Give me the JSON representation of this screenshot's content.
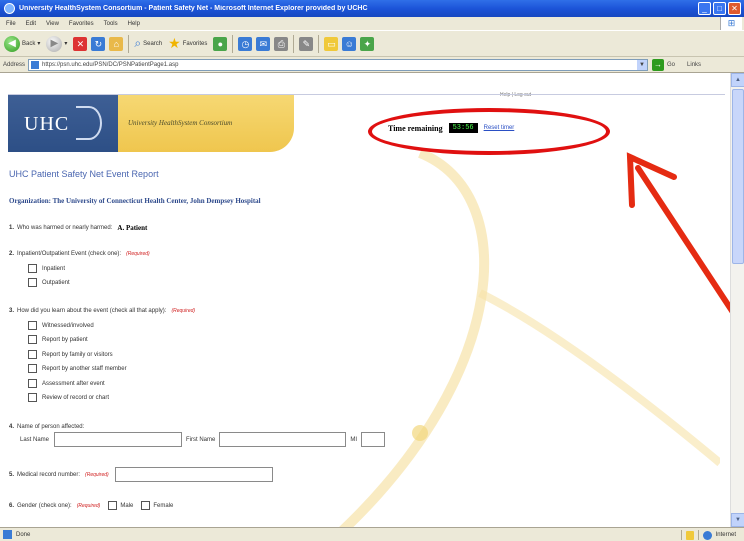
{
  "window": {
    "title": "University HealthSystem Consortium - Patient Safety Net - Microsoft Internet Explorer provided by UCHC",
    "minimize": "_",
    "maximize": "□",
    "close": "✕"
  },
  "menu": [
    "File",
    "Edit",
    "View",
    "Favorites",
    "Tools",
    "Help"
  ],
  "toolbar": {
    "back_label": "Back",
    "search_label": "Search",
    "favorites_label": "Favorites"
  },
  "address": {
    "label": "Address",
    "url": "https://psn.uhc.edu/PSN/DC/PSNPatientPage1.asp",
    "go_label": "Go",
    "links_label": "Links"
  },
  "header": {
    "logo_text": "UHC",
    "consortium": "University HealthSystem Consortium",
    "top_right_text": "Help  |  Log out"
  },
  "timer": {
    "label": "Time remaining",
    "value": "53:56",
    "reset_label": "Reset timer"
  },
  "report": {
    "title": "UHC Patient Safety Net Event Report",
    "organization": "Organization: The University of Connecticut Health Center, John Dempsey Hospital"
  },
  "required_text": "(Required)",
  "questions": {
    "q1": {
      "num": "1.",
      "text": "Who was harmed or nearly harmed:",
      "answer": "A. Patient"
    },
    "q2": {
      "num": "2.",
      "text": "Inpatient/Outpatient Event (check one):",
      "options": [
        "Inpatient",
        "Outpatient"
      ]
    },
    "q3": {
      "num": "3.",
      "text": "How did you learn about the event (check all that apply):",
      "options": [
        "Witnessed/involved",
        "Report by patient",
        "Report by family or visitors",
        "Report by another staff member",
        "Assessment after event",
        "Review of record or chart"
      ]
    },
    "q4": {
      "num": "4.",
      "text": "Name of person affected:",
      "last_name": "Last Name",
      "first_name": "First Name",
      "mi": "MI"
    },
    "q5": {
      "num": "5.",
      "text": "Medical record number:"
    },
    "q6": {
      "num": "6.",
      "text": "Gender (check one):",
      "options": [
        "Male",
        "Female"
      ]
    }
  },
  "status": {
    "text": "Done",
    "zone": "Internet"
  }
}
